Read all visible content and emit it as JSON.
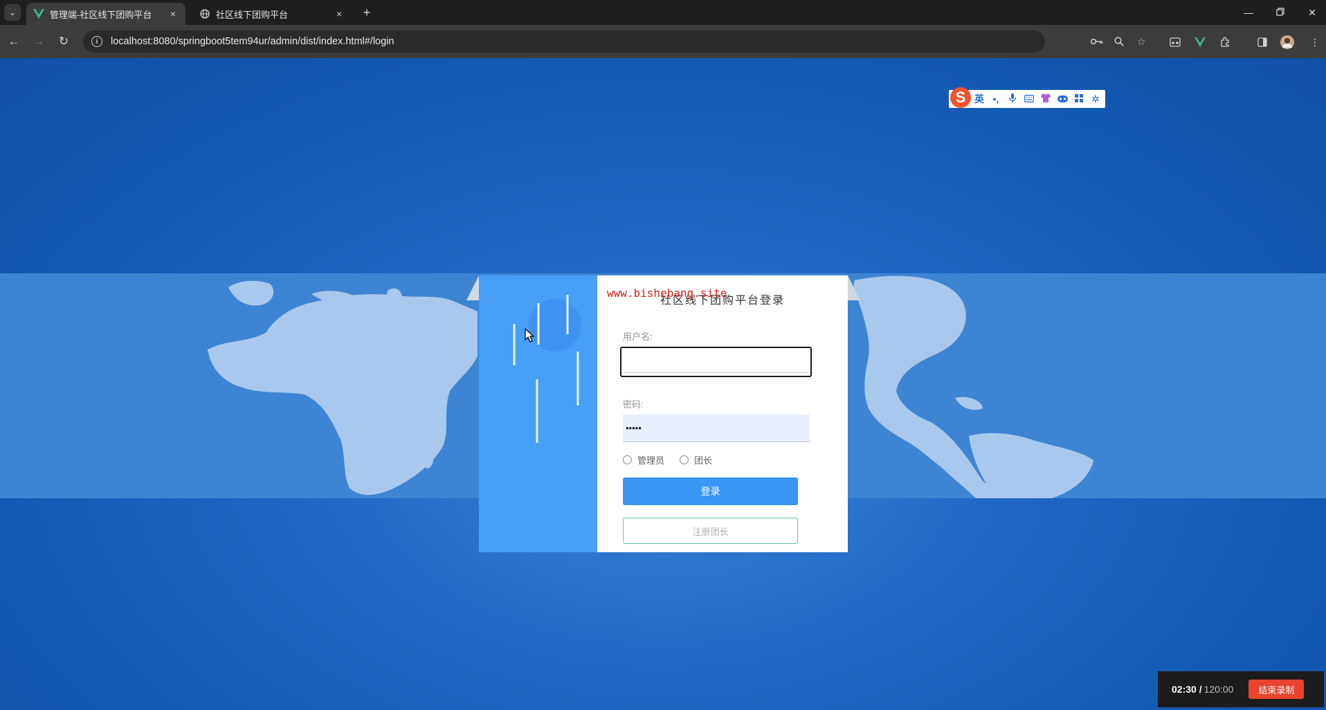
{
  "browser": {
    "tabs": [
      {
        "title": "管理端-社区线下团购平台",
        "active": true,
        "favicon": "vue-logo-icon"
      },
      {
        "title": "社区线下团购平台",
        "active": false,
        "favicon": "globe-icon"
      }
    ],
    "tab_close_glyph": "×",
    "new_tab_glyph": "+",
    "url": "localhost:8080/springboot5tem94ur/admin/dist/index.html#/login"
  },
  "ime": {
    "logo": "S",
    "lang_label": "英",
    "punct_label": "•,"
  },
  "login": {
    "title": "社区线下团购平台登录",
    "username_label": "用户名:",
    "password_label": "密码:",
    "password_value": "•••••",
    "roles": [
      "管理员",
      "团长"
    ],
    "login_button": "登录",
    "register_button": "注册团长"
  },
  "watermark": "www.bishebang.site",
  "recorder": {
    "elapsed": "02:30 /",
    "total": "120:00",
    "stop_button": "结束录制"
  },
  "colors": {
    "accent": "#3a96f5",
    "page_background": "#1565c0",
    "register_border": "#63c4ae",
    "record_stop": "#e8432e"
  }
}
